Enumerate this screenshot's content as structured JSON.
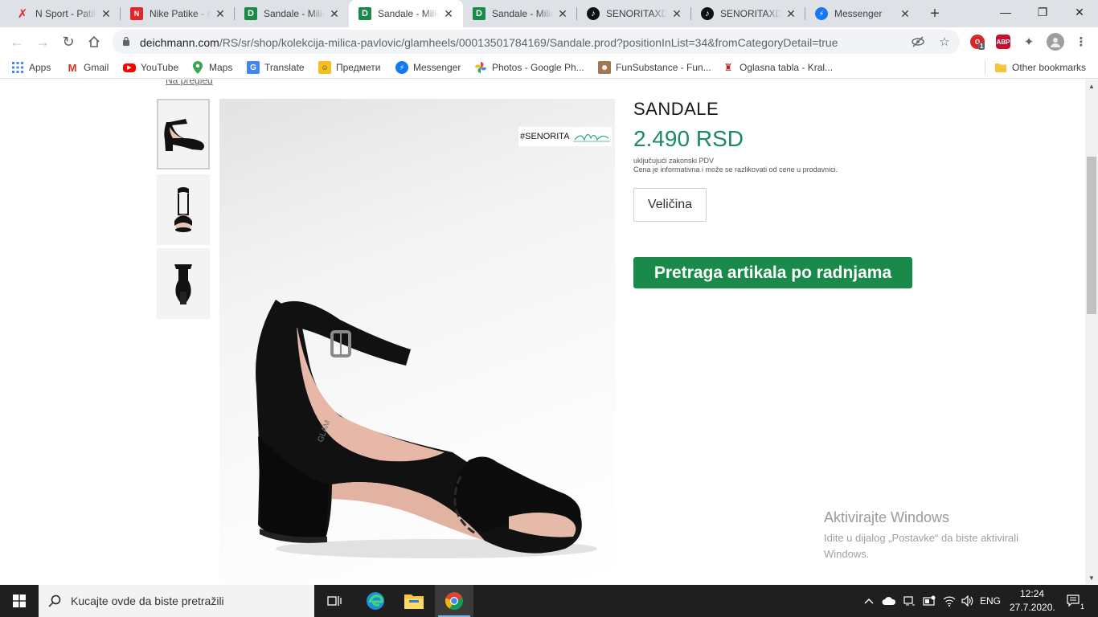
{
  "tabs": [
    {
      "title": "N Sport - Patike",
      "favicon": "nsport-icon",
      "active": false
    },
    {
      "title": "Nike Patike - sve",
      "favicon": "nike-icon",
      "active": false
    },
    {
      "title": "Sandale - Milica",
      "favicon": "deichmann-icon",
      "active": false
    },
    {
      "title": "Sandale - Milica",
      "favicon": "deichmann-icon",
      "active": true
    },
    {
      "title": "Sandale - Milica",
      "favicon": "deichmann-icon",
      "active": false
    },
    {
      "title": "SENORITAXDEI",
      "favicon": "tiktok-icon",
      "active": false
    },
    {
      "title": "SENORITAXDEI",
      "favicon": "tiktok-icon",
      "active": false
    },
    {
      "title": "Messenger",
      "favicon": "messenger-icon",
      "active": false
    }
  ],
  "address_bar": {
    "domain": "deichmann.com",
    "path": "/RS/sr/shop/kolekcija-milica-pavlovic/glamheels/00013501784169/Sandale.prod?positionInList=34&fromCategoryDetail=true"
  },
  "extensions": {
    "badge_count": "1",
    "abp_label": "ABP"
  },
  "bookmarks": [
    {
      "label": "Apps",
      "icon": "apps-grid-icon"
    },
    {
      "label": "Gmail",
      "icon": "gmail-icon"
    },
    {
      "label": "YouTube",
      "icon": "youtube-icon"
    },
    {
      "label": "Maps",
      "icon": "maps-icon"
    },
    {
      "label": "Translate",
      "icon": "translate-icon"
    },
    {
      "label": "Предмети",
      "icon": "classroom-icon"
    },
    {
      "label": "Messenger",
      "icon": "messenger-icon"
    },
    {
      "label": "Photos - Google Ph...",
      "icon": "photos-icon"
    },
    {
      "label": "FunSubstance - Fun...",
      "icon": "funsubstance-icon"
    },
    {
      "label": "Oglasna tabla - Kral...",
      "icon": "crest-icon"
    }
  ],
  "other_bookmarks": "Other bookmarks",
  "page": {
    "back_link": "Na pregled",
    "badge_text": "#SENORITA",
    "product_title": "SANDALE",
    "price": "2.490 RSD",
    "vat_note": "uključujući zakonski PDV",
    "price_note": "Cena je informativna i može se razlikovati od cene u prodavnici.",
    "size_button": "Veličina",
    "store_search_button": "Pretraga artikala po radnjama",
    "colors": {
      "price": "#1a8a62",
      "store_button": "#1a8a4a"
    }
  },
  "watermark": {
    "title": "Aktivirajte Windows",
    "text": "Idite u dijalog „Postavke“ da biste aktivirali Windows."
  },
  "taskbar": {
    "search_placeholder": "Kucajte ovde da biste pretražili",
    "language": "ENG",
    "time": "12:24",
    "date": "27.7.2020.",
    "notification_count": "1"
  }
}
